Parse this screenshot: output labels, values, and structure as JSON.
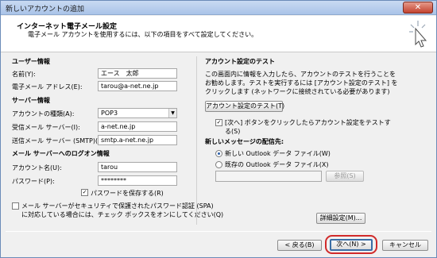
{
  "window": {
    "title": "新しいアカウントの追加",
    "close_glyph": "✕"
  },
  "header": {
    "title": "インターネット電子メール設定",
    "subtitle": "電子メール アカウントを使用するには、以下の項目をすべて設定してください。"
  },
  "user_info": {
    "heading": "ユーザー情報",
    "name_label": "名前(Y):",
    "name_value": "エース　太郎",
    "email_label": "電子メール アドレス(E):",
    "email_value": "tarou@a-net.ne.jp"
  },
  "server_info": {
    "heading": "サーバー情報",
    "type_label": "アカウントの種類(A):",
    "type_value": "POP3",
    "incoming_label": "受信メール サーバー(I):",
    "incoming_value": "a-net.ne.jp",
    "outgoing_label": "送信メール サーバー (SMTP)(O):",
    "outgoing_value": "smtp.a-net.ne.jp"
  },
  "logon_info": {
    "heading": "メール サーバーへのログオン情報",
    "account_label": "アカウント名(U):",
    "account_value": "tarou",
    "password_label": "パスワード(P):",
    "password_value": "********",
    "remember_label": "パスワードを保存する(R)",
    "spa_label_1": "メール サーバーがセキュリティで保護されたパスワード認証 (SPA)",
    "spa_label_2": "に対応している場合には、チェック ボックスをオンにしてください(Q)"
  },
  "test": {
    "heading": "アカウント設定のテスト",
    "desc_1": "この画面内に情報を入力したら、アカウントのテストを行うことを",
    "desc_2": "お勧めします。テストを実行するには [アカウント設定のテスト] を",
    "desc_3": "クリックします (ネットワークに接続されている必要があります)",
    "test_button": "アカウント設定のテスト(T)",
    "auto_test_1": "[次へ] ボタンをクリックしたらアカウント設定をテストす",
    "auto_test_2": "る(S)"
  },
  "delivery": {
    "heading": "新しいメッセージの配信先:",
    "new_file_label": "新しい Outlook データ ファイル(W)",
    "existing_file_label": "既存の Outlook データ ファイル(X)",
    "browse_button": "参照(S)"
  },
  "buttons": {
    "more_settings": "詳細設定(M)...",
    "back": "< 戻る(B)",
    "next": "次へ(N) >",
    "cancel": "キャンセル"
  },
  "check_glyph": "✓",
  "colors": {
    "highlight": "#d12a2a",
    "accent": "#3a6ea5"
  }
}
